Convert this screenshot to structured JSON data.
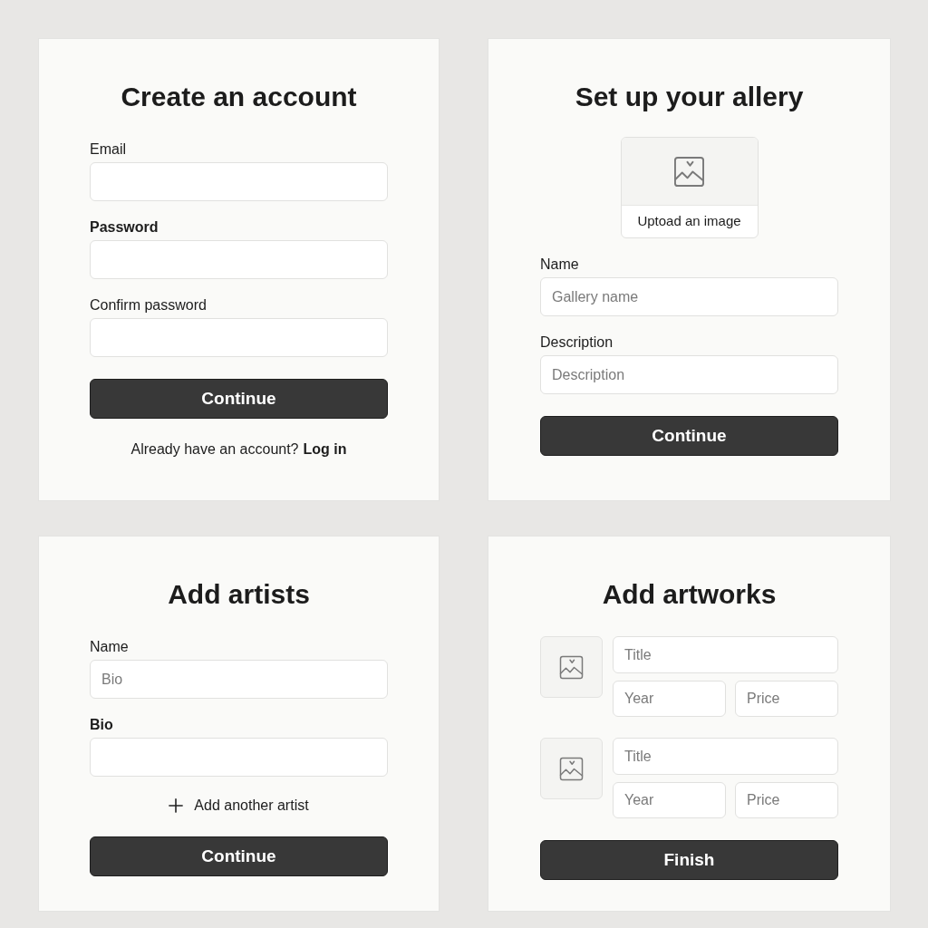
{
  "screens": [
    {
      "title": "Create an account",
      "items": [
        {
          "kind": "field",
          "label": "Email",
          "bold": false
        },
        {
          "kind": "field",
          "label": "Password",
          "bold": true
        },
        {
          "kind": "field",
          "label": "Confirm password",
          "bold": false
        },
        {
          "kind": "button",
          "label": "Continue"
        },
        {
          "kind": "footer",
          "text": "Already have an account?",
          "link": "Log in"
        }
      ]
    },
    {
      "title": "Set up your allery",
      "items": [
        {
          "kind": "upload",
          "label": "Uptoad an image"
        },
        {
          "kind": "field",
          "label": "Name",
          "bold": false,
          "placeholder": "Gallery name"
        },
        {
          "kind": "field",
          "label": "Description",
          "bold": false,
          "placeholder": "Description"
        },
        {
          "kind": "button",
          "label": "Continue"
        }
      ]
    },
    {
      "title": "Add artists",
      "items": [
        {
          "kind": "field",
          "label": "Name",
          "bold": false,
          "placeholder": "Bio"
        },
        {
          "kind": "field",
          "label": "Bio",
          "bold": true
        },
        {
          "kind": "add",
          "label": "Add another artist"
        },
        {
          "kind": "button",
          "label": "Continue"
        }
      ]
    },
    {
      "title": "Add artworks",
      "items": [
        {
          "kind": "artwork",
          "title_placeholder": "Title",
          "year_placeholder": "Year",
          "price_placeholder": "Price"
        },
        {
          "kind": "artwork",
          "title_placeholder": "Title",
          "year_placeholder": "Year",
          "price_placeholder": "Price"
        },
        {
          "kind": "button",
          "label": "Finish"
        }
      ]
    }
  ]
}
